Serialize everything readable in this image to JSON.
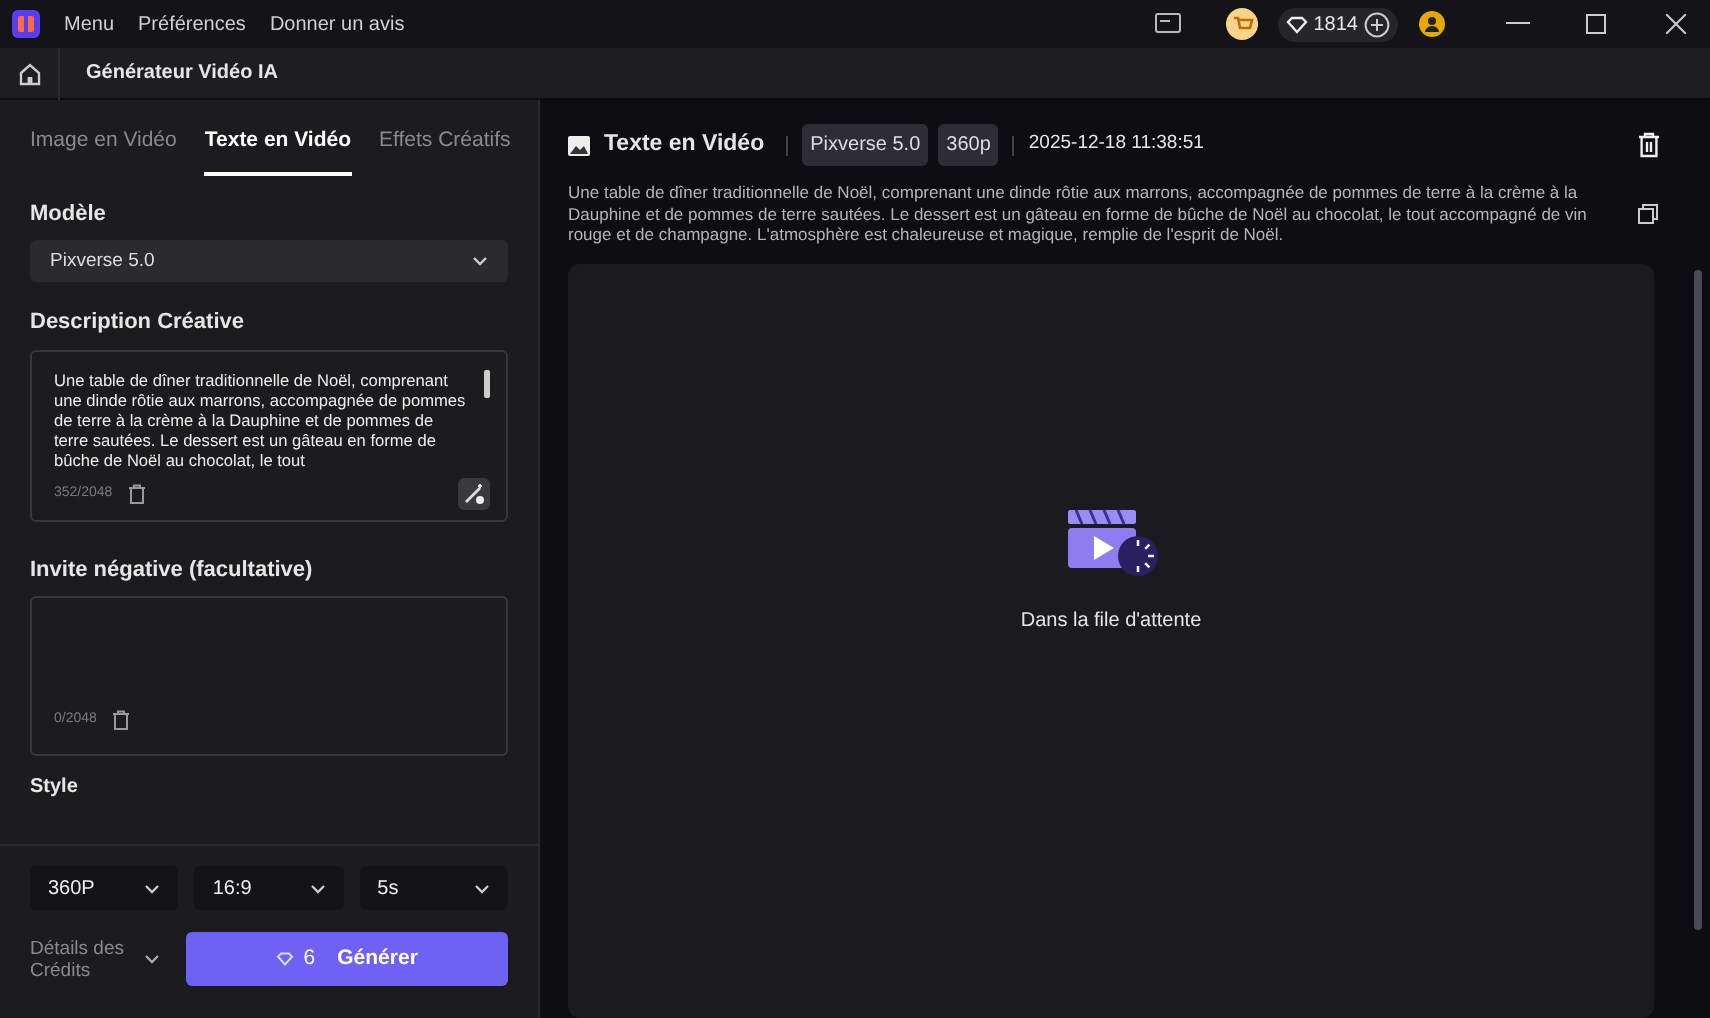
{
  "titlebar": {
    "menus": [
      "Menu",
      "Préférences",
      "Donner un avis"
    ],
    "credits": "1814"
  },
  "header": {
    "title": "Générateur Vidéo IA"
  },
  "tabs": [
    {
      "label": "Image en Vidéo",
      "selected": false
    },
    {
      "label": "Texte en Vidéo",
      "selected": true
    },
    {
      "label": "Effets Créatifs",
      "selected": false
    }
  ],
  "model": {
    "label": "Modèle",
    "value": "Pixverse 5.0"
  },
  "description": {
    "label": "Description Créative",
    "value": "Une table de dîner traditionnelle de Noël, comprenant une dinde rôtie aux marrons, accompagnée de pommes de terre à la crème à la Dauphine et de pommes de terre sautées. Le dessert est un gâteau en forme de bûche de Noël au chocolat, le tout",
    "count": "352/2048"
  },
  "negative": {
    "label": "Invite négative (facultative)",
    "count": "0/2048"
  },
  "style": {
    "label": "Style"
  },
  "options": [
    "360P",
    "16:9",
    "5s"
  ],
  "credits_details": "Détails des Crédits",
  "generate": {
    "cost": "6",
    "label": "Générer"
  },
  "task": {
    "title": "Texte en Vidéo",
    "tags": [
      "Pixverse 5.0",
      "360p"
    ],
    "date": "2025-12-18 11:38:51",
    "prompt": "Une table de dîner traditionnelle de Noël, comprenant une dinde rôtie aux marrons, accompagnée de pommes de terre à la crème à la Dauphine et de pommes de terre sautées. Le dessert est un gâteau en forme de bûche de Noël au chocolat, le tout accompagné de vin rouge et de champagne. L'atmosphère est chaleureuse et magique, remplie de l'esprit de Noël.",
    "status": "Dans la file d'attente"
  }
}
